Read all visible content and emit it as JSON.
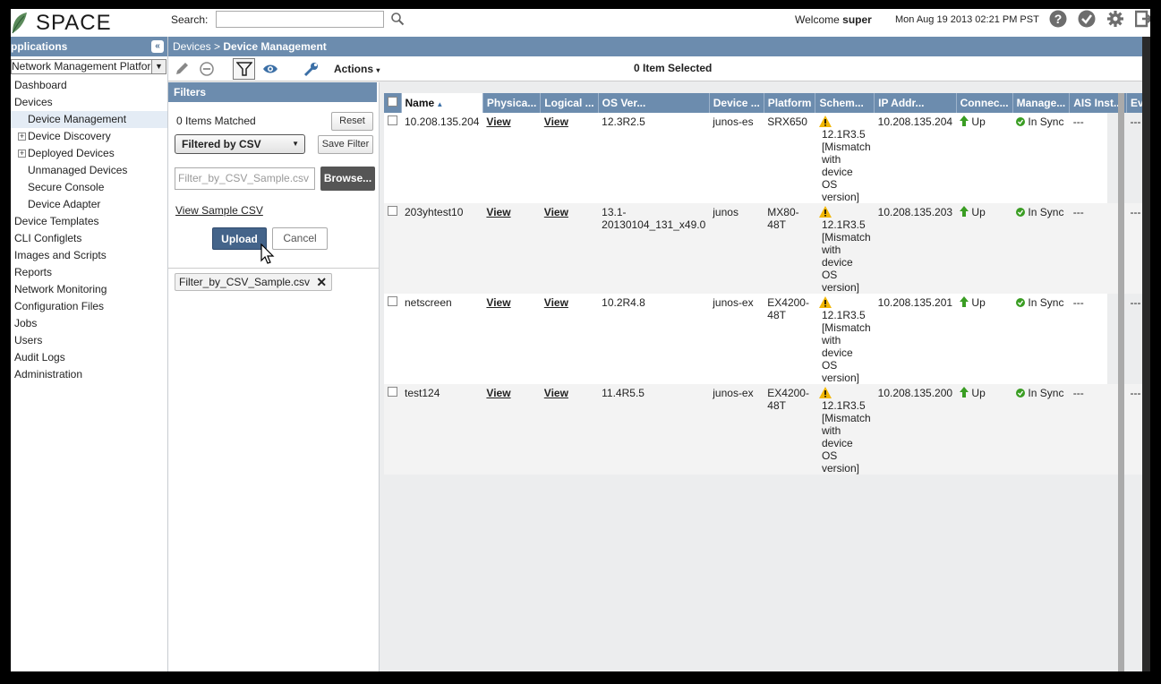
{
  "header": {
    "logo_text": "SPACE",
    "search_label": "Search:",
    "search_value": "",
    "welcome_prefix": "Welcome",
    "welcome_user": "super",
    "datetime": "Mon Aug 19 2013 02:21 PM PST",
    "icons": [
      "help-icon",
      "check-icon",
      "gear-icon",
      "logout-icon"
    ]
  },
  "sidebar": {
    "title": "pplications",
    "platform_select": "Network Management Platform",
    "items": [
      {
        "label": "Dashboard",
        "level": 0
      },
      {
        "label": "Devices",
        "level": 0
      },
      {
        "label": "Device Management",
        "level": 1,
        "selected": true
      },
      {
        "label": "Device Discovery",
        "level": 1,
        "expander": "+"
      },
      {
        "label": "Deployed Devices",
        "level": 1,
        "expander": "+"
      },
      {
        "label": "Unmanaged Devices",
        "level": 1
      },
      {
        "label": "Secure Console",
        "level": 1
      },
      {
        "label": "Device Adapter",
        "level": 1
      },
      {
        "label": "Device Templates",
        "level": 0
      },
      {
        "label": "CLI Configlets",
        "level": 0
      },
      {
        "label": "Images and Scripts",
        "level": 0
      },
      {
        "label": "Reports",
        "level": 0
      },
      {
        "label": "Network Monitoring",
        "level": 0
      },
      {
        "label": "Configuration Files",
        "level": 0
      },
      {
        "label": "Jobs",
        "level": 0
      },
      {
        "label": "Users",
        "level": 0
      },
      {
        "label": "Audit Logs",
        "level": 0
      },
      {
        "label": "Administration",
        "level": 0
      }
    ]
  },
  "breadcrumb": {
    "parent": "Devices",
    "separator": ">",
    "current": "Device Management"
  },
  "toolbar": {
    "actions_label": "Actions",
    "selected_count": "0 Item Selected"
  },
  "filters": {
    "title": "Filters",
    "matched": "0 Items Matched",
    "reset_label": "Reset",
    "filter_type": "Filtered by CSV",
    "save_filter_label": "Save Filter",
    "file_placeholder": "Filter_by_CSV_Sample.csv",
    "browse_label": "Browse...",
    "view_sample_label": "View Sample CSV",
    "upload_label": "Upload",
    "cancel_label": "Cancel",
    "active_tag": "Filter_by_CSV_Sample.csv"
  },
  "grid": {
    "columns": [
      "Name",
      "Physica...",
      "Logical ...",
      "OS Ver...",
      "Device ...",
      "Platform",
      "Schem...",
      "IP Addr...",
      "Connec...",
      "Manage...",
      "AIS Inst...",
      "Event P..."
    ],
    "rows": [
      {
        "name": "10.208.135.204",
        "physical": "View",
        "logical": "View",
        "os": "12.3R2.5",
        "device": "junos-es",
        "platform": "SRX650",
        "schema": "12.1R3.5 [Mismatch with device OS version]",
        "ip": "10.208.135.204",
        "conn": "Up",
        "manage": "In Sync",
        "ais": "---",
        "event": "---"
      },
      {
        "name": "203yhtest10",
        "physical": "View",
        "logical": "View",
        "os": "13.1-20130104_131_x49.0",
        "device": "junos",
        "platform": "MX80-48T",
        "schema": "12.1R3.5 [Mismatch with device OS version]",
        "ip": "10.208.135.203",
        "conn": "Up",
        "manage": "In Sync",
        "ais": "---",
        "event": "---"
      },
      {
        "name": "netscreen",
        "physical": "View",
        "logical": "View",
        "os": "10.2R4.8",
        "device": "junos-ex",
        "platform": "EX4200-48T",
        "schema": "12.1R3.5 [Mismatch with device OS version]",
        "ip": "10.208.135.201",
        "conn": "Up",
        "manage": "In Sync",
        "ais": "---",
        "event": "---"
      },
      {
        "name": "test124",
        "physical": "View",
        "logical": "View",
        "os": "11.4R5.5",
        "device": "junos-ex",
        "platform": "EX4200-48T",
        "schema": "12.1R3.5 [Mismatch with device OS version]",
        "ip": "10.208.135.200",
        "conn": "Up",
        "manage": "In Sync",
        "ais": "---",
        "event": "---"
      }
    ]
  },
  "colors": {
    "header_blue": "#6c8cae",
    "upload_blue": "#44648a",
    "up_green": "#3a9d23",
    "warn_yellow": "#f2b705"
  }
}
